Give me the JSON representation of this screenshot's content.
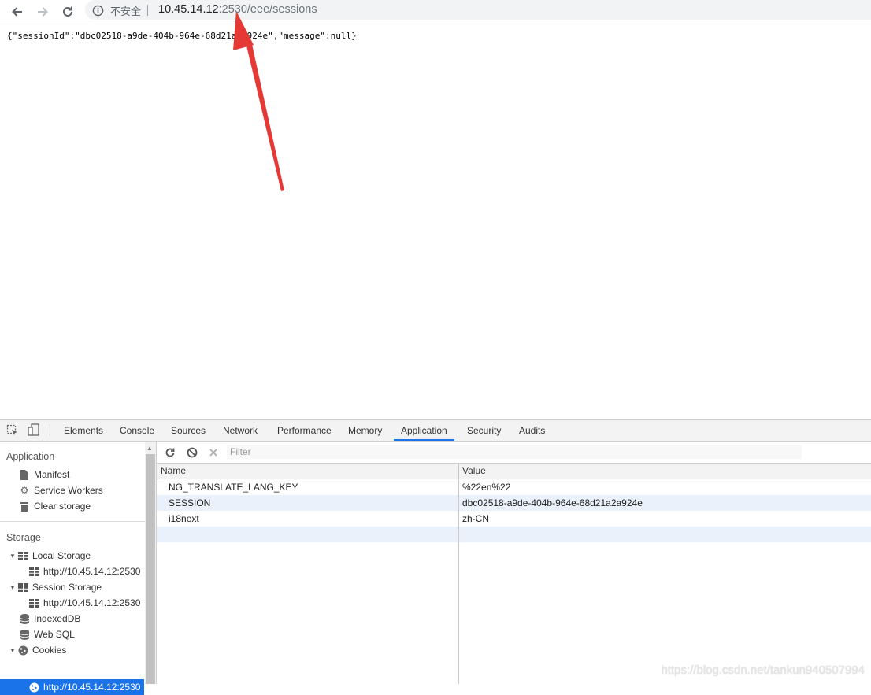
{
  "browser": {
    "security_label": "不安全",
    "url_host": "10.45.14.12",
    "url_port": ":2530",
    "url_path": "/eee/sessions"
  },
  "page": {
    "json_text": "{\"sessionId\":\"dbc02518-a9de-404b-964e-68d21a2a924e\",\"message\":null}"
  },
  "devtools": {
    "tabs": [
      "Elements",
      "Console",
      "Sources",
      "Network",
      "Performance",
      "Memory",
      "Application",
      "Security",
      "Audits"
    ],
    "active_tab": "Application",
    "sidebar": {
      "application_header": "Application",
      "manifest": "Manifest",
      "service_workers": "Service Workers",
      "clear_storage": "Clear storage",
      "storage_header": "Storage",
      "local_storage": "Local Storage",
      "local_storage_origin": "http://10.45.14.12:2530",
      "session_storage": "Session Storage",
      "session_storage_origin": "http://10.45.14.12:2530",
      "indexeddb": "IndexedDB",
      "websql": "Web SQL",
      "cookies": "Cookies",
      "cookies_origin": "http://10.45.14.12:2530"
    },
    "filter_placeholder": "Filter",
    "columns": {
      "name": "Name",
      "value": "Value"
    },
    "rows": [
      {
        "name": "NG_TRANSLATE_LANG_KEY",
        "value": "%22en%22"
      },
      {
        "name": "SESSION",
        "value": "dbc02518-a9de-404b-964e-68d21a2a924e"
      },
      {
        "name": "i18next",
        "value": "zh-CN"
      }
    ]
  },
  "watermark": "https://blog.csdn.net/tankun940507994",
  "colors": {
    "accent": "#1a73e8",
    "arrow": "#e53935",
    "row_alt": "#eaf1fb"
  }
}
